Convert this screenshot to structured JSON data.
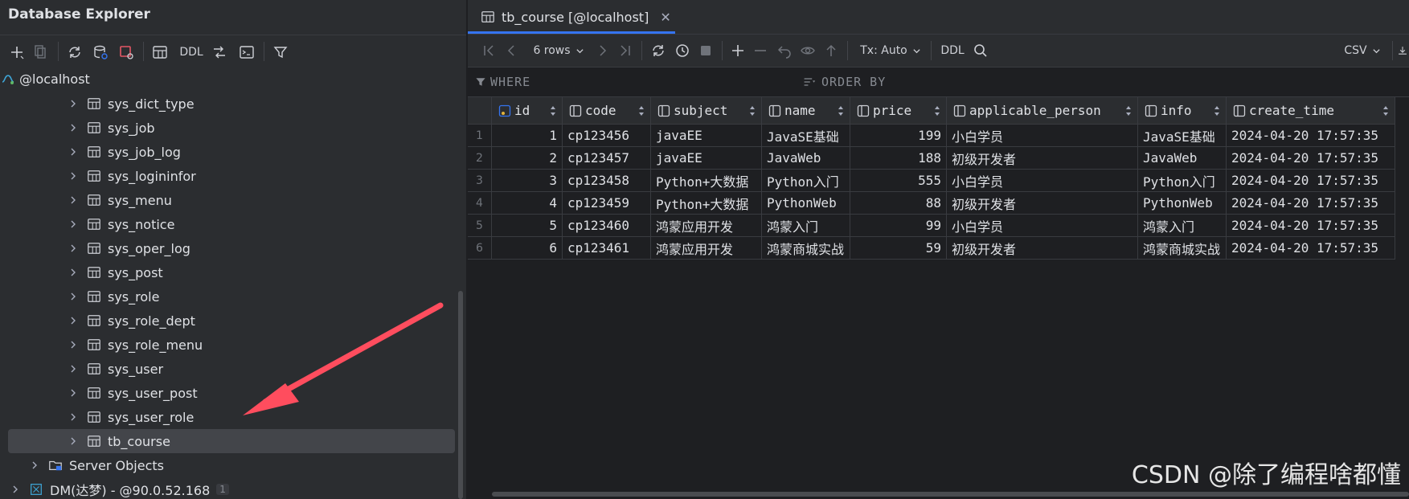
{
  "left": {
    "title": "Database Explorer",
    "toolbar": [
      "add",
      "copy",
      "refresh",
      "db-settings",
      "stop",
      "table",
      "DDL",
      "jump",
      "console",
      "filter"
    ],
    "ddl_label": "DDL",
    "root_label": "@localhost",
    "tables": [
      "sys_dict_type",
      "sys_job",
      "sys_job_log",
      "sys_logininfor",
      "sys_menu",
      "sys_notice",
      "sys_oper_log",
      "sys_post",
      "sys_role",
      "sys_role_dept",
      "sys_role_menu",
      "sys_user",
      "sys_user_post",
      "sys_user_role",
      "tb_course"
    ],
    "selected_table": "tb_course",
    "server_objects": "Server Objects",
    "dm_label": "DM(达梦) - @90.0.52.168",
    "dm_badge": "1"
  },
  "tab": {
    "label": "tb_course [@localhost]"
  },
  "toolbar": {
    "rows_label": "6 rows",
    "tx_label": "Tx: Auto",
    "ddl_label": "DDL",
    "csv_label": "CSV"
  },
  "filter": {
    "where": "WHERE",
    "order_by": "ORDER BY"
  },
  "grid": {
    "columns": [
      "id",
      "code",
      "subject",
      "name",
      "price",
      "applicable_person",
      "info",
      "create_time"
    ],
    "rows": [
      {
        "n": "1",
        "id": "1",
        "code": "cp123456",
        "subject": "javaEE",
        "name": "JavaSE基础",
        "price": "199",
        "person": "小白学员",
        "info": "JavaSE基础",
        "time": "2024-04-20 17:57:35"
      },
      {
        "n": "2",
        "id": "2",
        "code": "cp123457",
        "subject": "javaEE",
        "name": "JavaWeb",
        "price": "188",
        "person": "初级开发者",
        "info": "JavaWeb",
        "time": "2024-04-20 17:57:35"
      },
      {
        "n": "3",
        "id": "3",
        "code": "cp123458",
        "subject": "Python+大数据",
        "name": "Python入门",
        "price": "555",
        "person": "小白学员",
        "info": "Python入门",
        "time": "2024-04-20 17:57:35"
      },
      {
        "n": "4",
        "id": "4",
        "code": "cp123459",
        "subject": "Python+大数据",
        "name": "PythonWeb",
        "price": "88",
        "person": "初级开发者",
        "info": "PythonWeb",
        "time": "2024-04-20 17:57:35"
      },
      {
        "n": "5",
        "id": "5",
        "code": "cp123460",
        "subject": "鸿蒙应用开发",
        "name": "鸿蒙入门",
        "price": "99",
        "person": "小白学员",
        "info": "鸿蒙入门",
        "time": "2024-04-20 17:57:35"
      },
      {
        "n": "6",
        "id": "6",
        "code": "cp123461",
        "subject": "鸿蒙应用开发",
        "name": "鸿蒙商城实战",
        "price": "59",
        "person": "初级开发者",
        "info": "鸿蒙商城实战",
        "time": "2024-04-20 17:57:35"
      }
    ]
  },
  "watermark": "CSDN @除了编程啥都懂",
  "colors": {
    "accent": "#3574f0",
    "arrow": "#ff4d5e",
    "panel": "#2b2d30",
    "editor": "#1e1f22"
  }
}
